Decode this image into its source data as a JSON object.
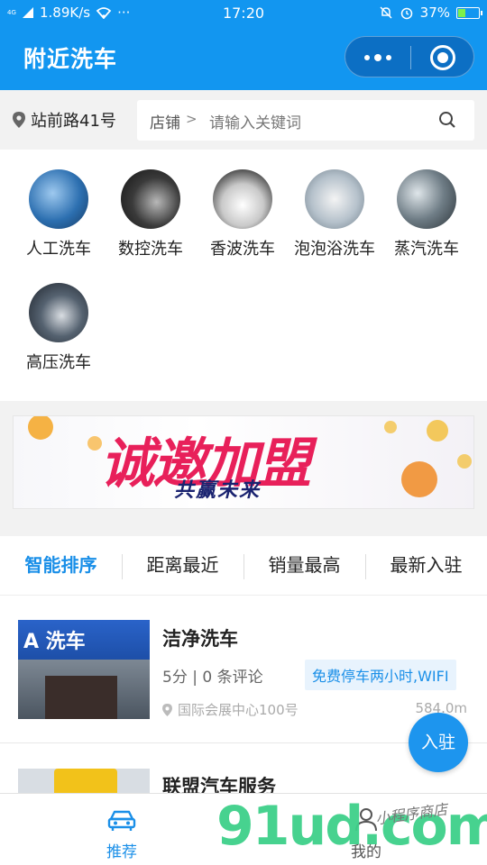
{
  "status_bar": {
    "network_type": "4G",
    "speed": "1.89K/s",
    "more": "···",
    "time": "17:20",
    "battery_percent": "37%",
    "battery_level": 0.37
  },
  "header": {
    "title": "附近洗车"
  },
  "location": {
    "address": "站前路41号"
  },
  "search": {
    "scope": "店铺",
    "chevron": ">",
    "placeholder": "请输入关键词"
  },
  "categories": [
    {
      "label": "人工洗车",
      "icon": "manual-wash-photo"
    },
    {
      "label": "数控洗车",
      "icon": "cnc-wash-photo"
    },
    {
      "label": "香波洗车",
      "icon": "shampoo-wash-photo"
    },
    {
      "label": "泡泡浴洗车",
      "icon": "bubble-wash-photo"
    },
    {
      "label": "蒸汽洗车",
      "icon": "steam-wash-photo"
    },
    {
      "label": "高压洗车",
      "icon": "high-pressure-wash-photo"
    }
  ],
  "banner": {
    "headline": "诚邀加盟",
    "subline": "共赢未来"
  },
  "sort_tabs": [
    {
      "label": "智能排序",
      "active": true
    },
    {
      "label": "距离最近",
      "active": false
    },
    {
      "label": "销量最高",
      "active": false
    },
    {
      "label": "最新入驻",
      "active": false
    }
  ],
  "shops": [
    {
      "name": "洁净洗车",
      "rating": "5分 | 0 条评论",
      "tag": "免费停车两小时,WIFI",
      "address": "国际会展中心100号",
      "distance": "584.0m",
      "thumb_text": "A 洗车"
    },
    {
      "name": "联盟汽车服务"
    }
  ],
  "fab": {
    "label": "入驻"
  },
  "bottom_nav": [
    {
      "label": "推荐",
      "icon": "car-icon",
      "active": true
    },
    {
      "label": "我的",
      "icon": "user-icon",
      "active": false
    }
  ],
  "watermark": {
    "main": "91ud.com",
    "sub": "小程序商店"
  },
  "colors": {
    "primary": "#1296f0",
    "accent": "#1a8fe8",
    "tag_bg": "#e8f3fd"
  }
}
